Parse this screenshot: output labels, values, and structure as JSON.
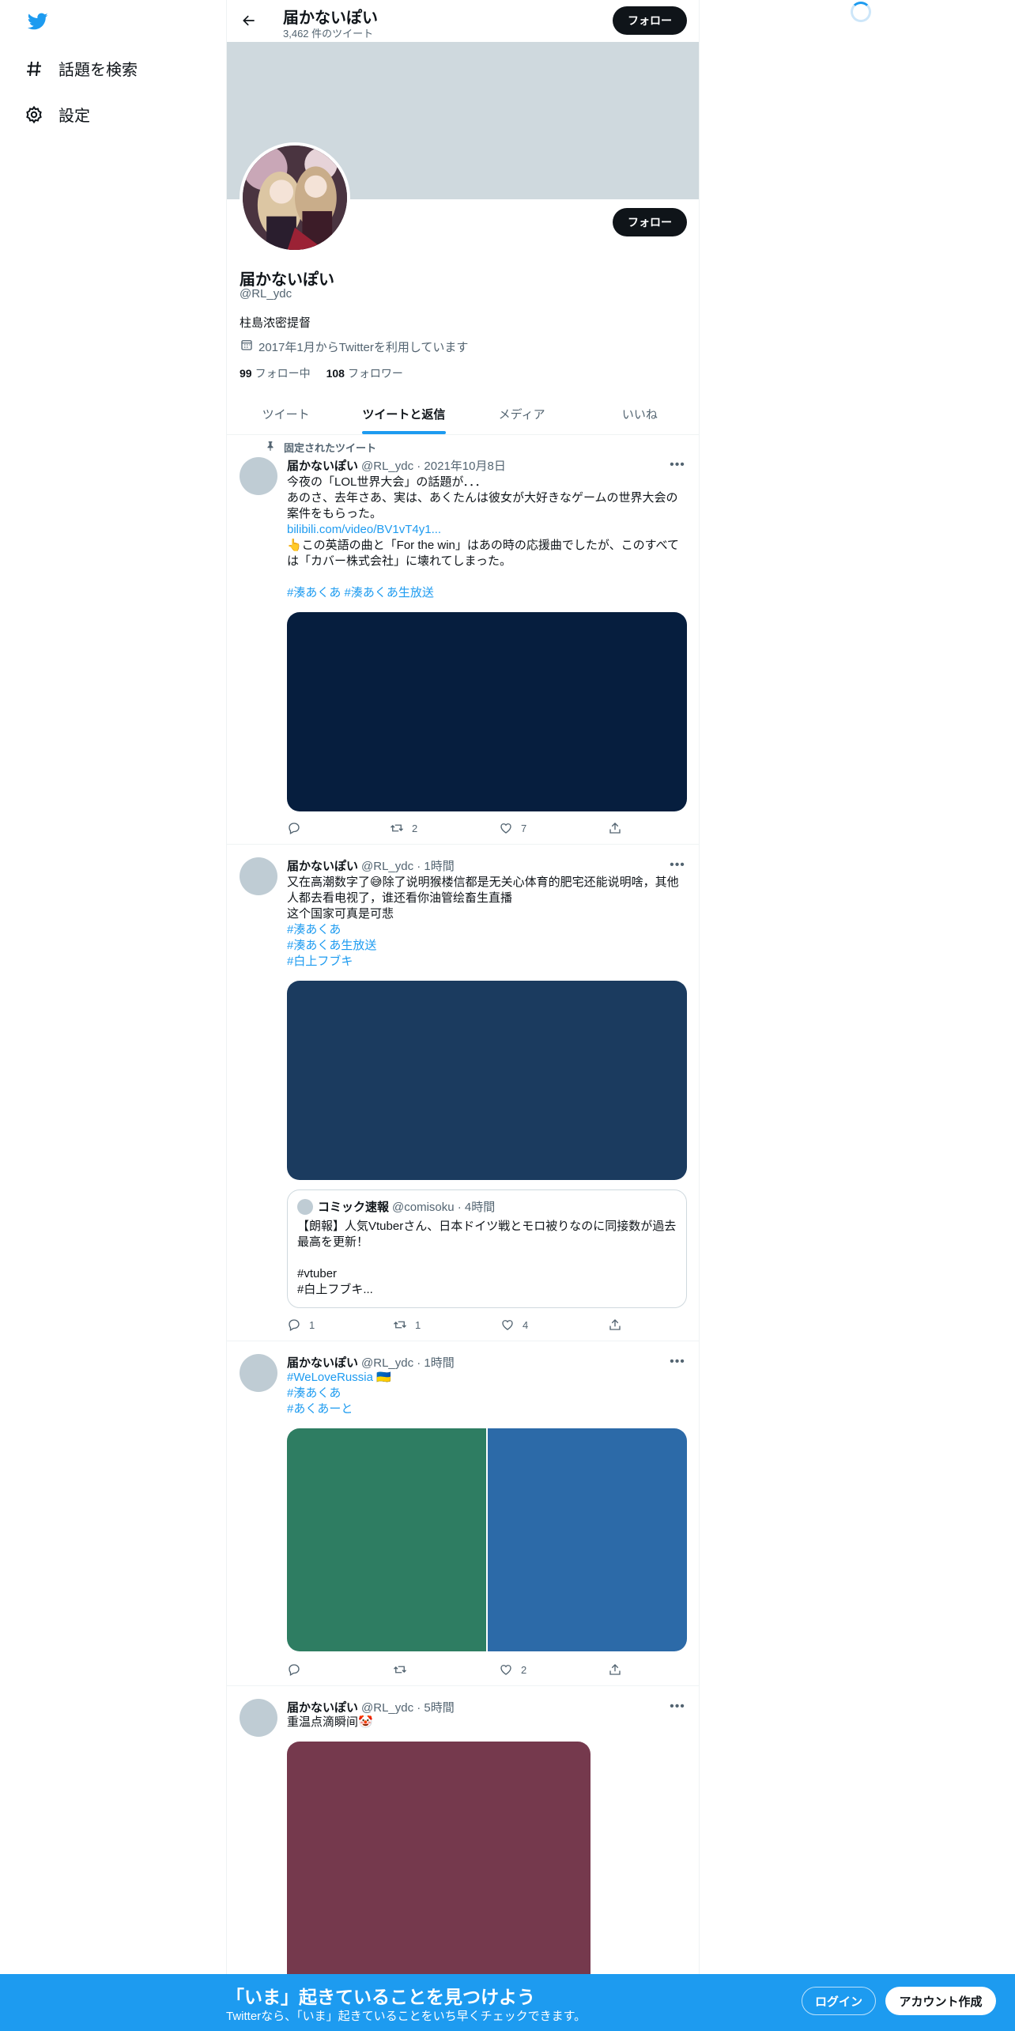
{
  "nav": {
    "explore_label": "話題を検索",
    "settings_label": "設定"
  },
  "header": {
    "name": "届かないぽい",
    "tweet_count": "3,462 件のツイート",
    "follow_label": "フォロー"
  },
  "profile": {
    "name": "届かないぽい",
    "handle": "@RL_ydc",
    "bio": "柱島浓密提督",
    "joined": "2017年1月からTwitterを利用しています",
    "following_count": "99",
    "following_label": "フォロー中",
    "followers_count": "108",
    "followers_label": "フォロワー",
    "follow_label": "フォロー"
  },
  "tabs": [
    "ツイート",
    "ツイートと返信",
    "メディア",
    "いいね"
  ],
  "active_tab": "ツイートと返信",
  "tweets": [
    {
      "pinned_label": "固定されたツイート",
      "name": "届かないぽい",
      "meta": "@RL_ydc · 2021年10月8日",
      "lines": [
        "今夜の「LOL世界大会」の話題が．．．",
        "あのさ、去年さあ、実は、あくたんは彼女が大好きなゲームの世界大会の",
        "案件をもらった。"
      ],
      "link": "bilibili.com/video/BV1vT4y1...",
      "lines2": [
        "👆この英語の曲と「For the win」はあの時の応援曲でしたが、このすべて",
        "は「カバー株式会社」に壊れてしまった。",
        ""
      ],
      "hashtags": "#湊あくあ #湊あくあ生放送",
      "media_color": "#061e3e",
      "reply": "",
      "retweet": "2",
      "like": "7"
    },
    {
      "name": "届かないぽい",
      "meta": "@RL_ydc · 1時間",
      "lines": [
        "又在高潮数字了😅除了说明猴楼信都是无关心体育的肥宅还能说明啥，其他",
        "人都去看电视了，谁还看你油管绘畜生直播",
        "这个国家可真是可悲"
      ],
      "hashtags_list": [
        "#湊あくあ",
        "#湊あくあ生放送",
        "#白上フブキ"
      ],
      "media_color": "#1b3b5f",
      "quote": {
        "name": "コミック速報",
        "meta": "@comisoku · 4時間",
        "lines": [
          "【朗報】人気Vtuberさん、日本ドイツ戦とモロ被りなのに同接数が過去",
          "最高を更新！",
          "",
          "#vtuber",
          "#白上フブキ..."
        ]
      },
      "reply": "1",
      "retweet": "1",
      "like": "4"
    },
    {
      "name": "届かないぽい",
      "meta": "@RL_ydc · 1時間",
      "tag1": "#WeLoveRussia",
      "flag": "🇺🇦",
      "hashtags_list": [
        "#湊あくあ",
        "#あくあーと"
      ],
      "media_colors": [
        "#2e7d62",
        "#2c6aa8"
      ],
      "reply": "",
      "retweet": "",
      "like": "2"
    },
    {
      "name": "届かないぽい",
      "meta": "@RL_ydc · 5時間",
      "text": "重温点滴瞬间🤡",
      "media_color": "#75394d"
    }
  ],
  "bottom": {
    "title": "「いま」起きていることを見つけよう",
    "subtitle": "Twitterなら、「いま」起きていることをいち早くチェックできます。",
    "login": "ログイン",
    "signup": "アカウント作成"
  }
}
